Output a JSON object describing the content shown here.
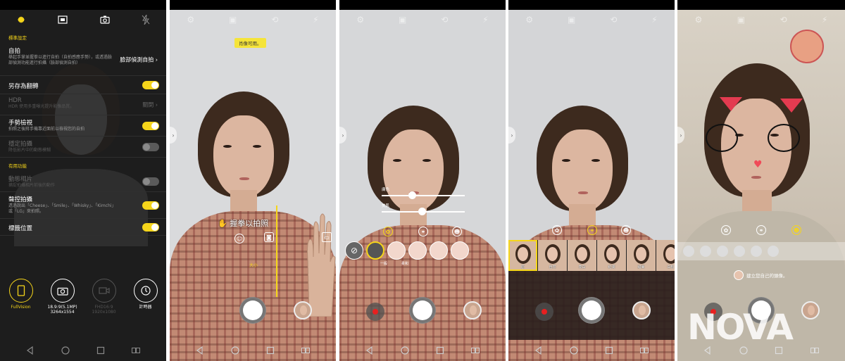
{
  "panel1": {
    "section_standard": "標準設定",
    "rows": [
      {
        "title": "自拍",
        "desc": "舉起手掌並握拳以進行自拍（自拍感應手勢），或透過臉部偵測功能進行拍攝（臉部偵測自拍）",
        "value": "臉部偵測自拍"
      },
      {
        "title": "另存為翻轉",
        "desc": ""
      },
      {
        "title": "HDR",
        "desc": "HDR 使用多重曝光提升影像品質。",
        "value": "關閉"
      },
      {
        "title": "手勢檢視",
        "desc": "拍照之後將手機靠近面前以檢視您的自拍"
      },
      {
        "title": "穩定拍攝",
        "desc": "降低影片中的動態模糊"
      }
    ],
    "section_useful": "有用功能",
    "rows2": [
      {
        "title": "動態相片",
        "desc": "捕捉拍攝相片前後的動作"
      },
      {
        "title": "聲控拍攝",
        "desc": "透過說出「Cheese」、「Smile」、「Whisky」、「Kimchi」或「LG」來拍照。"
      },
      {
        "title": "標籤位置",
        "desc": ""
      }
    ],
    "modes": [
      {
        "label": "FullVision",
        "sub": ""
      },
      {
        "label": "18.9:9(5.1MP)",
        "sub": "3264x1554"
      },
      {
        "label": "FHD16:9",
        "sub": "1920x1080"
      },
      {
        "label": "計時器",
        "sub": ""
      }
    ]
  },
  "panel2": {
    "tip": "肖像可用。",
    "gesture": "握拳以拍照",
    "bracket_label": "大小"
  },
  "panel3": {
    "slider1": "膚色",
    "slider2": "美肌",
    "fx_label1": "一般",
    "fx_label2": "柔和"
  },
  "panel4": {
    "filters": [
      "原",
      "自然",
      "亮白",
      "紅潤",
      "甜美",
      "白皙"
    ]
  },
  "panel5": {
    "create_msg": "建立您自己的頭像。"
  },
  "watermark": "NOVA"
}
